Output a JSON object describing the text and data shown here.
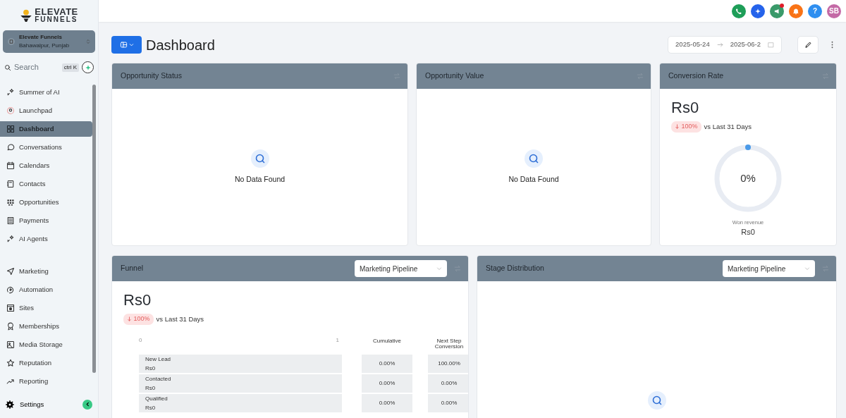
{
  "sidebar": {
    "logo": {
      "line_1": "ELEVATE",
      "line_2": "FUNNELS"
    },
    "account": {
      "name": "Elevate Funnels",
      "location": "Bahawalpur, Punjab"
    },
    "search": {
      "placeholder": "Search",
      "shortcut": "ctrl K"
    },
    "nav_groups": [
      [
        {
          "label": "Summer of AI",
          "selected": false
        },
        {
          "label": "Launchpad",
          "selected": false
        },
        {
          "label": "Dashboard",
          "selected": true
        },
        {
          "label": "Conversations",
          "selected": false
        },
        {
          "label": "Calendars",
          "selected": false
        },
        {
          "label": "Contacts",
          "selected": false
        },
        {
          "label": "Opportunities",
          "selected": false
        },
        {
          "label": "Payments",
          "selected": false
        },
        {
          "label": "AI Agents",
          "selected": false
        }
      ],
      [
        {
          "label": "Marketing",
          "selected": false
        },
        {
          "label": "Automation",
          "selected": false
        },
        {
          "label": "Sites",
          "selected": false
        },
        {
          "label": "Memberships",
          "selected": false
        },
        {
          "label": "Media Storage",
          "selected": false
        },
        {
          "label": "Reputation",
          "selected": false
        },
        {
          "label": "Reporting",
          "selected": false
        }
      ]
    ],
    "settings": {
      "label": "Settings"
    }
  },
  "topbar": {
    "actions": [
      {
        "kind": "phone",
        "color": "#1e9e58",
        "notification": false
      },
      {
        "kind": "sparkle",
        "color": "#2563eb",
        "notification": false
      },
      {
        "kind": "megaphone",
        "color": "#3a9a6a",
        "notification": true
      },
      {
        "kind": "bell",
        "color": "#f97316",
        "notification": false
      },
      {
        "kind": "help",
        "color": "#2f8ff0",
        "text": "?",
        "notification": false
      },
      {
        "kind": "avatar",
        "color": "#c46aa6",
        "text": "SB",
        "notification": false
      }
    ]
  },
  "header": {
    "title": "Dashboard",
    "date_from": "2025-05-24",
    "date_to": "2025-06-2"
  },
  "widgets": [
    {
      "kind": "empty",
      "title": "Opportunity Status",
      "message": "No Data Found"
    },
    {
      "kind": "empty",
      "title": "Opportunity Value",
      "message": "No Data Found"
    },
    {
      "kind": "gauge",
      "title": "Conversion Rate",
      "amount": "Rs0",
      "change": "100%",
      "comparison": "vs Last 31 Days",
      "reading": "0%",
      "caption": "Won revenue",
      "caption_value": "Rs0"
    },
    {
      "kind": "funnel",
      "title": "Funnel",
      "pipeline": "Marketing Pipeline",
      "amount": "Rs0",
      "change": "100%",
      "comparison": "vs Last 31 Days",
      "axis": [
        "0",
        "1"
      ],
      "columns": [
        "Cumulative",
        "Next Step Conversion"
      ],
      "rows": [
        {
          "stage": "New Lead",
          "value": "Rs0",
          "cumulative": "0.00%",
          "next": "100.00%"
        },
        {
          "stage": "Contacted",
          "value": "Rs0",
          "cumulative": "0.00%",
          "next": "0.00%"
        },
        {
          "stage": "Qualified",
          "value": "Rs0",
          "cumulative": "0.00%",
          "next": "0.00%"
        }
      ]
    },
    {
      "kind": "distribution",
      "title": "Stage Distribution",
      "pipeline": "Marketing Pipeline"
    }
  ]
}
